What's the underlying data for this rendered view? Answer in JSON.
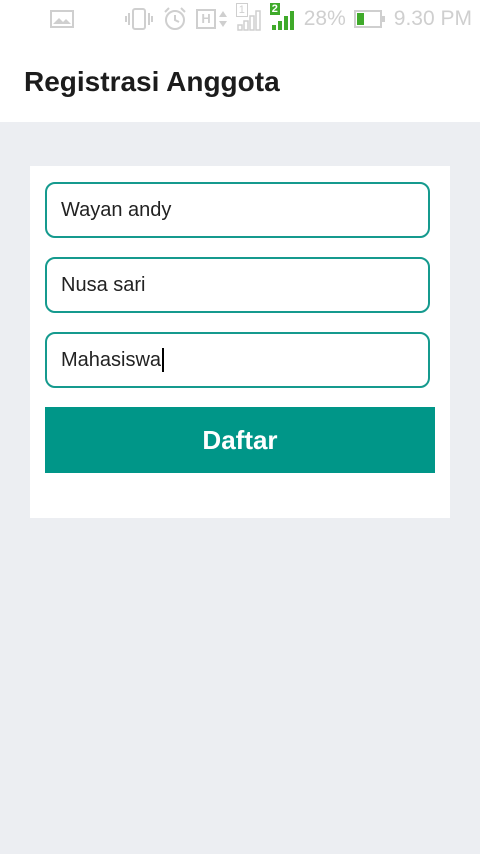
{
  "status_bar": {
    "network_type": "H",
    "sim_slot": "1",
    "sim2_slot": "2",
    "battery_percent": "28%",
    "time": "9.30 PM",
    "icons": [
      "gallery-icon",
      "vibrate-icon",
      "alarm-icon",
      "network-type-icon",
      "signal-icon",
      "signal2-icon",
      "battery-icon"
    ],
    "accent": "#3faa2a"
  },
  "appbar": {
    "title": "Registrasi Anggota"
  },
  "form": {
    "fields": [
      {
        "value": "Wayan andy"
      },
      {
        "value": "Nusa sari"
      },
      {
        "value": "Mahasiswa"
      }
    ],
    "submit_label": "Daftar"
  },
  "colors": {
    "primary": "#009688",
    "field_border": "#159a8e",
    "background": "#eceef2"
  }
}
